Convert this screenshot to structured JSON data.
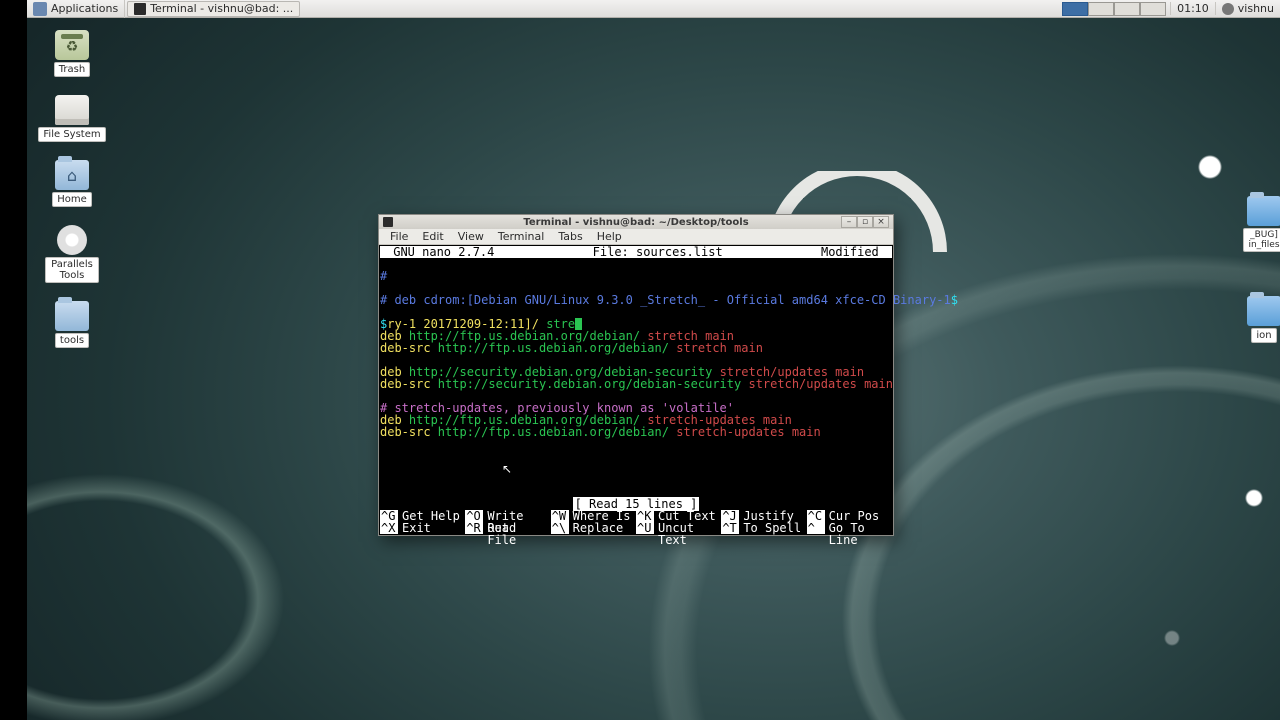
{
  "panel": {
    "applications": "Applications",
    "task": "Terminal - vishnu@bad: ...",
    "clock": "01:10",
    "user": "vishnu"
  },
  "desktop_icons": {
    "trash": "Trash",
    "filesystem": "File System",
    "home": "Home",
    "parallels": "Parallels Tools",
    "tools": "tools",
    "right1": "_BUG]",
    "right1b": "in_files",
    "right2": "ion"
  },
  "window": {
    "title": "Terminal - vishnu@bad: ~/Desktop/tools",
    "menu": {
      "file": "File",
      "edit": "Edit",
      "view": "View",
      "terminal": "Terminal",
      "tabs": "Tabs",
      "help": "Help"
    }
  },
  "nano": {
    "version": " GNU nano 2.7.4",
    "file": "File: sources.list",
    "modified": "Modified ",
    "lines": {
      "l1": "#",
      "l2a": "# deb cdrom:[Debian GNU/Linux 9.3.0 _Stretch_ - Official amd64 xfce-CD Binary-1",
      "l2b": "$",
      "l3a": "$",
      "l3b": "ry-1 20171209-12:11]/ ",
      "l3c": "stre",
      "l4a": "deb ",
      "l4b": "http://ftp.us.debian.org/debian/ ",
      "l4c": "stretch main",
      "l5a": "deb-src ",
      "l5b": "http://ftp.us.debian.org/debian/ ",
      "l5c": "stretch main",
      "l6a": "deb ",
      "l6b": "http://security.debian.org/debian-security ",
      "l6c": "stretch/updates main",
      "l7a": "deb-src ",
      "l7b": "http://security.debian.org/debian-security ",
      "l7c": "stretch/updates main",
      "l8": "# stretch-updates, previously known as 'volatile'",
      "l9a": "deb ",
      "l9b": "http://ftp.us.debian.org/debian/ ",
      "l9c": "stretch-updates main",
      "l10a": "deb-src ",
      "l10b": "http://ftp.us.debian.org/debian/ ",
      "l10c": "stretch-updates main"
    },
    "status": "[ Read 15 lines ]",
    "shortcuts": {
      "g": {
        "k": "^G",
        "t": "Get Help"
      },
      "o": {
        "k": "^O",
        "t": "Write Out"
      },
      "w": {
        "k": "^W",
        "t": "Where Is"
      },
      "k": {
        "k": "^K",
        "t": "Cut Text"
      },
      "j": {
        "k": "^J",
        "t": "Justify"
      },
      "c": {
        "k": "^C",
        "t": "Cur Pos"
      },
      "x": {
        "k": "^X",
        "t": "Exit"
      },
      "r": {
        "k": "^R",
        "t": "Read File"
      },
      "bs": {
        "k": "^\\",
        "t": "Replace"
      },
      "u": {
        "k": "^U",
        "t": "Uncut Text"
      },
      "t": {
        "k": "^T",
        "t": "To Spell"
      },
      "sl": {
        "k": "^_",
        "t": "Go To Line"
      }
    }
  }
}
